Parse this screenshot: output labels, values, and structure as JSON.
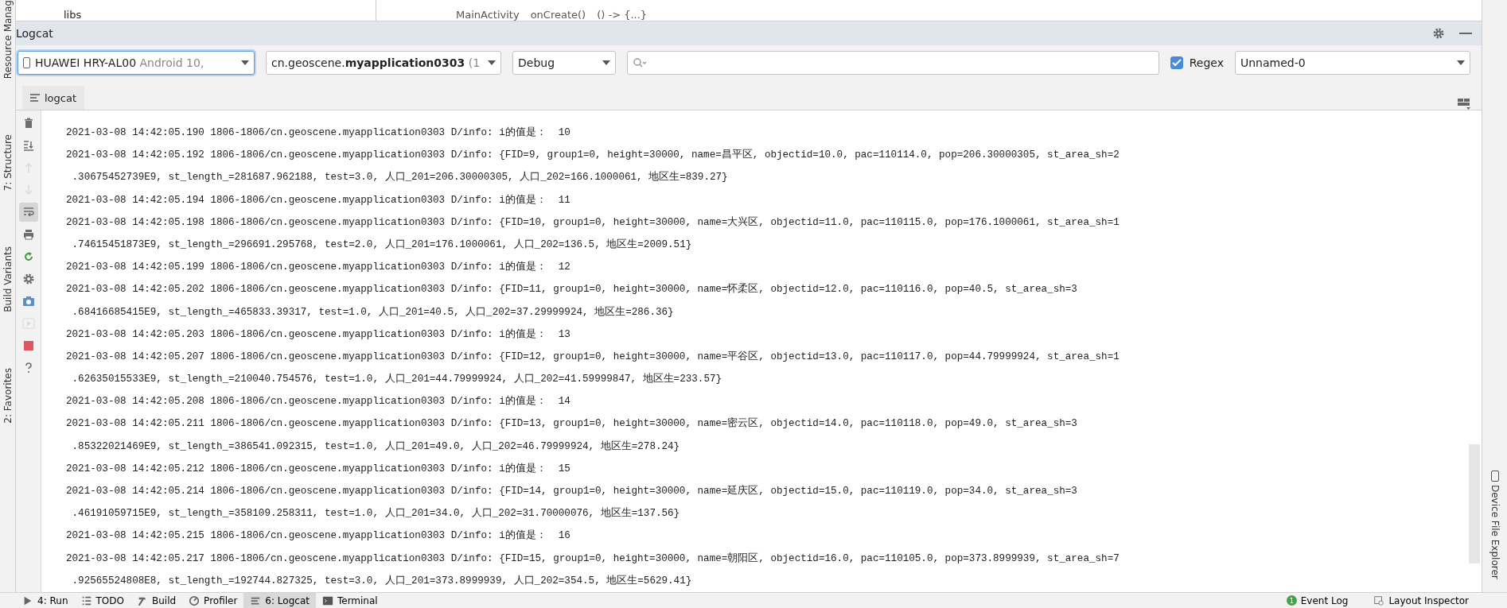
{
  "top_strip": {
    "tree_item": "libs",
    "breadcrumb": [
      "MainActivity",
      "onCreate()",
      "() -> {...}"
    ]
  },
  "left_strip": [
    "Resource Manag",
    "7: Structure",
    "Build Variants",
    "2: Favorites"
  ],
  "right_strip": [
    "Device File Explorer"
  ],
  "panel": {
    "title": "Logcat"
  },
  "toolbar": {
    "device": {
      "name": "HUAWEI HRY-AL00",
      "detail": "Android 10, "
    },
    "process": {
      "prefix": "cn.geoscene.",
      "bold": "myapplication0303",
      "suffix": " (1"
    },
    "level": "Debug",
    "regex": {
      "label": "Regex",
      "checked": true
    },
    "filter": "Unnamed-0"
  },
  "tab": {
    "label": "logcat"
  },
  "side_tools": [
    {
      "kind": "trash",
      "disabled": false,
      "selected": false
    },
    {
      "kind": "scroll-end",
      "disabled": false,
      "selected": false
    },
    {
      "kind": "up",
      "disabled": true,
      "selected": false
    },
    {
      "kind": "down",
      "disabled": true,
      "selected": false
    },
    {
      "kind": "wrap",
      "disabled": false,
      "selected": true
    },
    {
      "kind": "print",
      "disabled": false,
      "selected": false
    },
    {
      "kind": "restart",
      "disabled": false,
      "selected": false
    },
    {
      "kind": "settings",
      "disabled": false,
      "selected": false
    },
    {
      "kind": "camera",
      "disabled": false,
      "selected": false
    },
    {
      "kind": "video",
      "disabled": true,
      "selected": false
    },
    {
      "kind": "stop",
      "disabled": false,
      "selected": false
    },
    {
      "kind": "help",
      "disabled": false,
      "selected": false
    }
  ],
  "log_lines": [
    "2021-03-08 14:42:05.190 1806-1806/cn.geoscene.myapplication0303 D/info: i的值是：  10",
    "2021-03-08 14:42:05.192 1806-1806/cn.geoscene.myapplication0303 D/info: {FID=9, group1=0, height=30000, name=昌平区, objectid=10.0, pac=110114.0, pop=206.30000305, st_area_sh=2",
    " .30675452739E9, st_length_=281687.962188, test=3.0, 人口_201=206.30000305, 人口_202=166.1000061, 地区生=839.27}",
    "2021-03-08 14:42:05.194 1806-1806/cn.geoscene.myapplication0303 D/info: i的值是：  11",
    "2021-03-08 14:42:05.198 1806-1806/cn.geoscene.myapplication0303 D/info: {FID=10, group1=0, height=30000, name=大兴区, objectid=11.0, pac=110115.0, pop=176.1000061, st_area_sh=1",
    " .74615451873E9, st_length_=296691.295768, test=2.0, 人口_201=176.1000061, 人口_202=136.5, 地区生=2009.51}",
    "2021-03-08 14:42:05.199 1806-1806/cn.geoscene.myapplication0303 D/info: i的值是：  12",
    "2021-03-08 14:42:05.202 1806-1806/cn.geoscene.myapplication0303 D/info: {FID=11, group1=0, height=30000, name=怀柔区, objectid=12.0, pac=110116.0, pop=40.5, st_area_sh=3",
    " .68416685415E9, st_length_=465833.39317, test=1.0, 人口_201=40.5, 人口_202=37.29999924, 地区生=286.36}",
    "2021-03-08 14:42:05.203 1806-1806/cn.geoscene.myapplication0303 D/info: i的值是：  13",
    "2021-03-08 14:42:05.207 1806-1806/cn.geoscene.myapplication0303 D/info: {FID=12, group1=0, height=30000, name=平谷区, objectid=13.0, pac=110117.0, pop=44.79999924, st_area_sh=1",
    " .62635015533E9, st_length_=210040.754576, test=1.0, 人口_201=44.79999924, 人口_202=41.59999847, 地区生=233.57}",
    "2021-03-08 14:42:05.208 1806-1806/cn.geoscene.myapplication0303 D/info: i的值是：  14",
    "2021-03-08 14:42:05.211 1806-1806/cn.geoscene.myapplication0303 D/info: {FID=13, group1=0, height=30000, name=密云区, objectid=14.0, pac=110118.0, pop=49.0, st_area_sh=3",
    " .85322021469E9, st_length_=386541.092315, test=1.0, 人口_201=49.0, 人口_202=46.79999924, 地区生=278.24}",
    "2021-03-08 14:42:05.212 1806-1806/cn.geoscene.myapplication0303 D/info: i的值是：  15",
    "2021-03-08 14:42:05.214 1806-1806/cn.geoscene.myapplication0303 D/info: {FID=14, group1=0, height=30000, name=延庆区, objectid=15.0, pac=110119.0, pop=34.0, st_area_sh=3",
    " .46191059715E9, st_length_=358109.258311, test=1.0, 人口_201=34.0, 人口_202=31.70000076, 地区生=137.56}",
    "2021-03-08 14:42:05.215 1806-1806/cn.geoscene.myapplication0303 D/info: i的值是：  16",
    "2021-03-08 14:42:05.217 1806-1806/cn.geoscene.myapplication0303 D/info: {FID=15, group1=0, height=30000, name=朝阳区, objectid=16.0, pac=110105.0, pop=373.8999939, st_area_sh=7",
    " .92565524808E8, st_length_=192744.827325, test=3.0, 人口_201=373.8999939, 人口_202=354.5, 地区生=5629.41}"
  ],
  "bottom_tabs": [
    {
      "kind": "run",
      "label": "4: Run",
      "selected": false
    },
    {
      "kind": "todo",
      "label": "TODO",
      "selected": false
    },
    {
      "kind": "build",
      "label": "Build",
      "selected": false
    },
    {
      "kind": "profiler",
      "label": "Profiler",
      "selected": false
    },
    {
      "kind": "logcat",
      "label": "6: Logcat",
      "selected": true
    },
    {
      "kind": "terminal",
      "label": "Terminal",
      "selected": false
    }
  ],
  "bottom_right": [
    {
      "kind": "event",
      "label": "Event Log",
      "badge": "1"
    },
    {
      "kind": "inspector",
      "label": "Layout Inspector"
    }
  ]
}
